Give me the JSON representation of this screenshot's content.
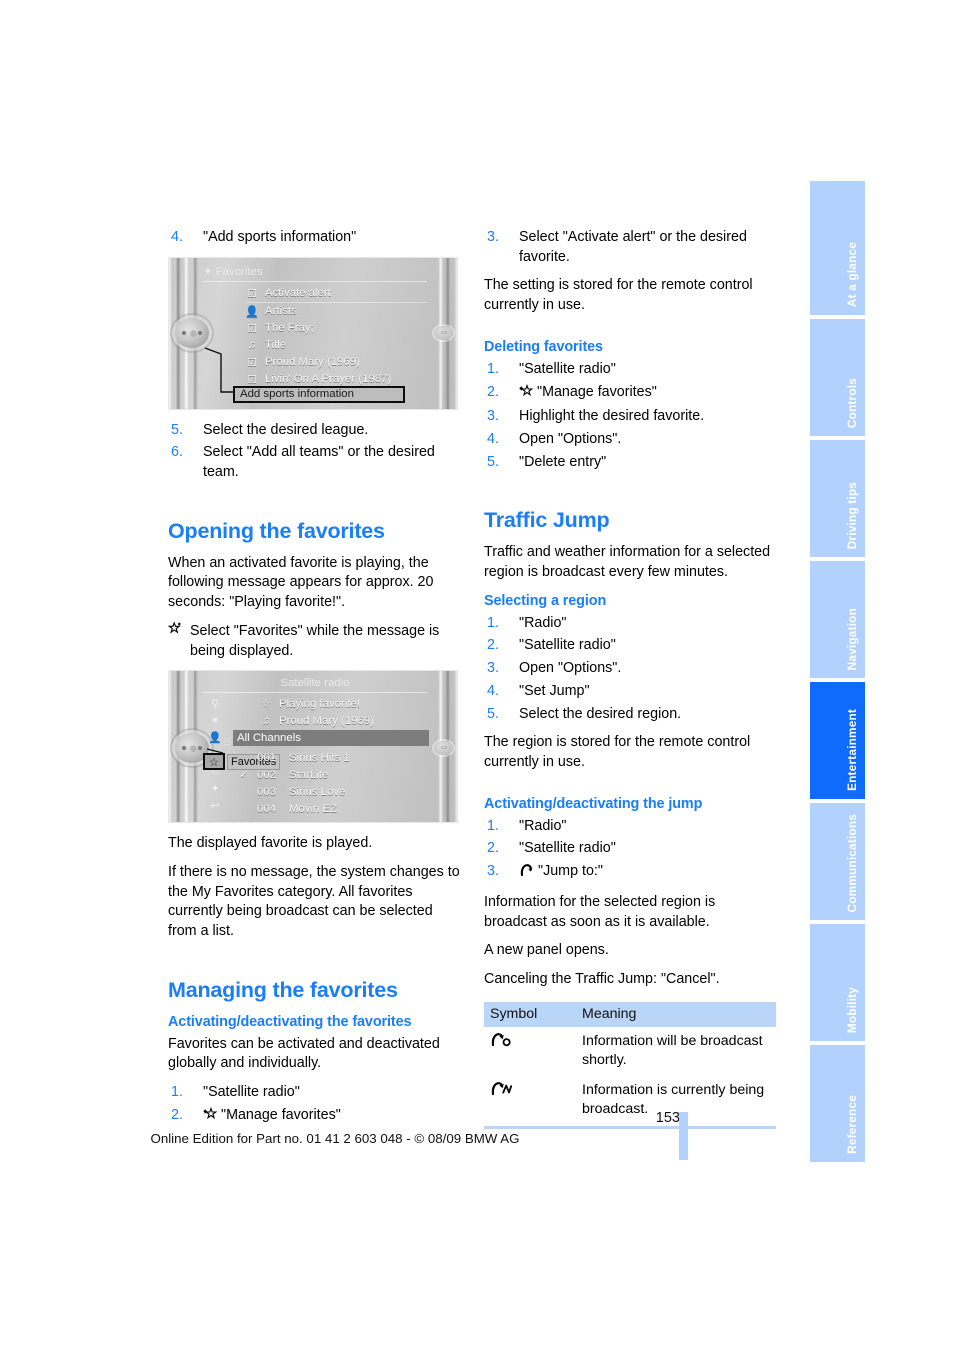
{
  "page": {
    "number": "153",
    "footer": "Online Edition for Part no. 01 41 2 603 048 - © 08/09 BMW AG"
  },
  "sidebar": {
    "tabs": [
      {
        "label": "At a glance",
        "active": false
      },
      {
        "label": "Controls",
        "active": false
      },
      {
        "label": "Driving tips",
        "active": false
      },
      {
        "label": "Navigation",
        "active": false
      },
      {
        "label": "Entertainment",
        "active": true
      },
      {
        "label": "Communications",
        "active": false
      },
      {
        "label": "Mobility",
        "active": false
      },
      {
        "label": "Reference",
        "active": false
      }
    ]
  },
  "left_column": {
    "step4": {
      "num": "4.",
      "text": "\"Add sports information\""
    },
    "figure1": {
      "title": "Favorites",
      "title_icon": "favorites-icon",
      "rows": [
        {
          "icon": "checkbox-checked",
          "label": "Activate alert"
        },
        {
          "icon": "artist-icon",
          "label": "Artists"
        },
        {
          "icon": "checkbox-checked",
          "label": "The Fray;"
        },
        {
          "icon": "music-note",
          "label": "Title"
        },
        {
          "icon": "checkbox-checked",
          "label": "Proud Mary (1969)"
        },
        {
          "icon": "checkbox-checked",
          "label": "Livin' On A Prayer (1987)"
        }
      ],
      "selection": "Add sports information"
    },
    "step5": {
      "num": "5.",
      "text": "Select the desired league."
    },
    "step6": {
      "num": "6.",
      "text": "Select \"Add all teams\" or the desired team."
    },
    "heading_opening": "Opening the favorites",
    "opening_para": "When an activated favorite is playing, the following message appears for approx. 20 seconds: \"Playing favorite!\".",
    "opening_bullet": {
      "icon": "star-favorite-icon",
      "text": "Select \"Favorites\" while the message is being displayed."
    },
    "figure2": {
      "title": "Satellite radio",
      "corner_icon": "favorites-icon",
      "info_rows": [
        {
          "icon": "star-outline",
          "label": "Playing favorite!"
        },
        {
          "icon": "music-note",
          "label": "Proud Mary (1969)"
        }
      ],
      "section_header": "All Channels",
      "channels": [
        {
          "check": "",
          "number": "001",
          "name": "Sirius Hits 1"
        },
        {
          "check": "✓",
          "number": "002",
          "name": "StarLite"
        },
        {
          "check": "",
          "number": "003",
          "name": "Sirius Love"
        },
        {
          "check": "",
          "number": "004",
          "name": "Movin EZ"
        }
      ],
      "tooltip": "Favorites",
      "sidebar_icons": [
        "search-icon",
        "category-icon",
        "artist-icon",
        "clock-icon",
        "star-favorite-icon",
        "star-add-icon",
        "jump-icon"
      ]
    },
    "caption1": "The displayed favorite is played.",
    "caption2": "If there is no message, the system changes to the My Favorites category. All favorites currently being broadcast can be selected from a list.",
    "heading_managing": "Managing the favorites",
    "subheading_activating": "Activating/deactivating the favorites",
    "managing_para": "Favorites can be activated and deactivated globally and individually.",
    "managing_steps": [
      {
        "num": "1.",
        "icon": "",
        "text": "\"Satellite radio\""
      },
      {
        "num": "2.",
        "icon": "star-add-icon",
        "text": "\"Manage favorites\""
      }
    ]
  },
  "right_column": {
    "step3": {
      "num": "3.",
      "text": "Select \"Activate alert\" or the desired favorite."
    },
    "setting_para": "The setting is stored for the remote control currently in use.",
    "heading_deleting": "Deleting favorites",
    "deleting_steps": [
      {
        "num": "1.",
        "icon": "",
        "text": "\"Satellite radio\""
      },
      {
        "num": "2.",
        "icon": "star-add-icon",
        "text": "\"Manage favorites\""
      },
      {
        "num": "3.",
        "icon": "",
        "text": "Highlight the desired favorite."
      },
      {
        "num": "4.",
        "icon": "",
        "text": "Open \"Options\"."
      },
      {
        "num": "5.",
        "icon": "",
        "text": "\"Delete entry\""
      }
    ],
    "heading_traffic_jump": "Traffic Jump",
    "traffic_para": "Traffic and weather information for a selected region is broadcast every few minutes.",
    "subheading_selecting": "Selecting a region",
    "selecting_steps": [
      {
        "num": "1.",
        "icon": "",
        "text": "\"Radio\""
      },
      {
        "num": "2.",
        "icon": "",
        "text": "\"Satellite radio\""
      },
      {
        "num": "3.",
        "icon": "",
        "text": "Open \"Options\"."
      },
      {
        "num": "4.",
        "icon": "",
        "text": "\"Set Jump\""
      },
      {
        "num": "5.",
        "icon": "",
        "text": "Select the desired region."
      }
    ],
    "region_para": "The region is stored for the remote control currently in use.",
    "subheading_activating_jump": "Activating/deactivating the jump",
    "jump_steps": [
      {
        "num": "1.",
        "icon": "",
        "text": "\"Radio\""
      },
      {
        "num": "2.",
        "icon": "",
        "text": "\"Satellite radio\""
      },
      {
        "num": "3.",
        "icon": "jump-icon",
        "text": "\"Jump to:\""
      }
    ],
    "jump_para1": "Information for the selected region is broadcast as soon as it is available.",
    "jump_para2": "A new panel opens.",
    "jump_para3": "Canceling the Traffic Jump: \"Cancel\".",
    "symbol_table": {
      "headers": [
        "Symbol",
        "Meaning"
      ],
      "rows": [
        {
          "symbol_icon": "jump-pending-icon",
          "meaning": "Information will be broadcast shortly."
        },
        {
          "symbol_icon": "jump-active-icon",
          "meaning": "Information is currently being broadcast."
        }
      ]
    }
  },
  "colors": {
    "accent_blue": "#1a7dfa",
    "tab_blue": "#b2d2fd",
    "tab_active_blue": "#0f6bfb",
    "table_header_blue": "#b9d5f7"
  }
}
